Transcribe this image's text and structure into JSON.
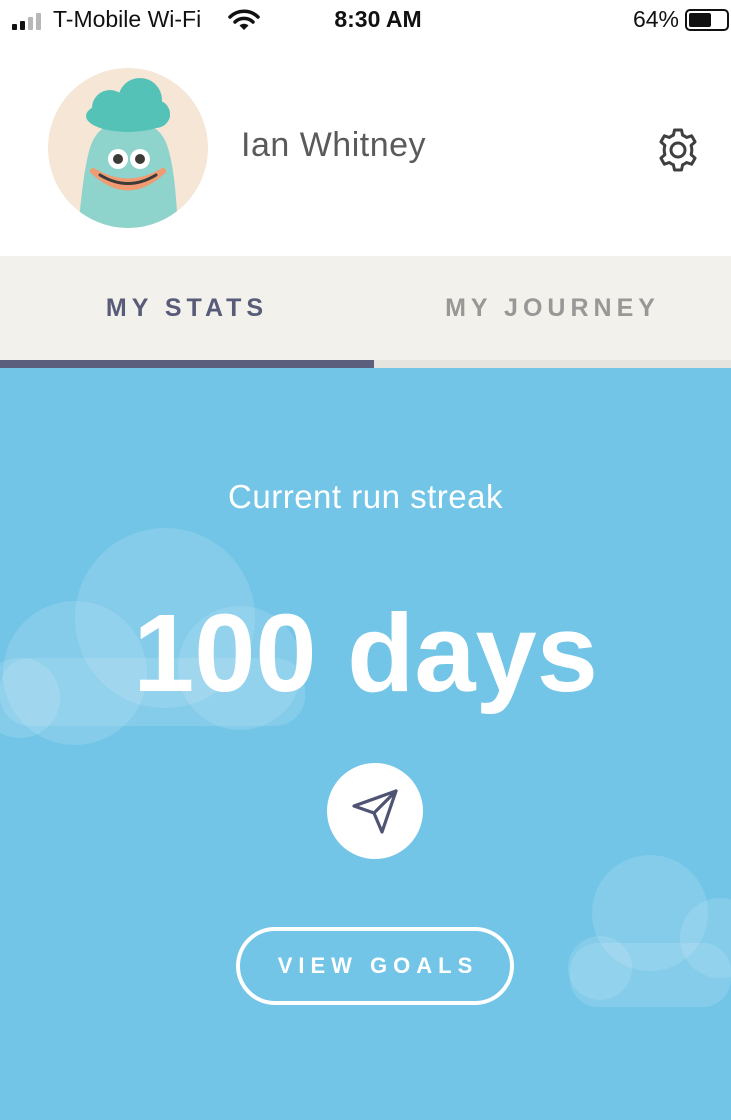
{
  "status_bar": {
    "carrier": "T-Mobile Wi-Fi",
    "time": "8:30 AM",
    "battery_percent": "64%",
    "battery_level": 0.64,
    "signal_bars": 2,
    "signal_icon": "cellular-signal-icon",
    "wifi_icon": "wifi-icon",
    "battery_icon": "battery-icon"
  },
  "profile": {
    "name": "Ian Whitney",
    "avatar_icon": "blob-character-avatar",
    "settings_icon": "gear-icon"
  },
  "tabs": [
    {
      "label": "MY STATS",
      "active": true
    },
    {
      "label": "MY JOURNEY",
      "active": false
    }
  ],
  "stats": {
    "streak_label": "Current run streak",
    "streak_value": "100 days",
    "share_icon": "paper-plane-icon",
    "goals_button_label": "VIEW GOALS"
  },
  "colors": {
    "hero_background": "#72c5e7",
    "tab_active": "#585c78",
    "tab_inactive": "#999896",
    "tab_bar_background": "#f3f1ec",
    "avatar_background": "#f5e6d6",
    "avatar_body": "#8fd3cd"
  }
}
